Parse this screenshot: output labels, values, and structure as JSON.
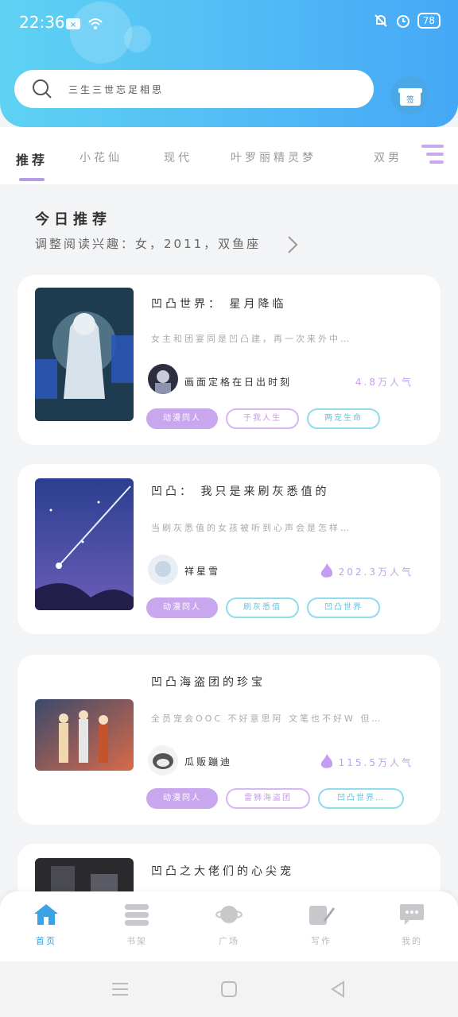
{
  "status": {
    "time": "22:36",
    "battery": "78"
  },
  "search": {
    "placeholder": "三生三世忘足相思"
  },
  "sign_in": {
    "label": "签"
  },
  "tabs": [
    {
      "label": "推荐",
      "active": true
    },
    {
      "label": "小花仙",
      "active": false
    },
    {
      "label": "现代",
      "active": false
    },
    {
      "label": "叶罗丽精灵梦",
      "active": false
    },
    {
      "label": "双男",
      "active": false
    }
  ],
  "recommend": {
    "title": "今日推荐",
    "subtitle": "调整阅读兴趣：女，2011，双鱼座"
  },
  "books": [
    {
      "title": "凹凸世界： 星月降临",
      "desc": "女主和团宴同是凹凸建，再一次来外中…",
      "author": "画面定格在日出时刻",
      "heat": "4.8万人气",
      "hot": false,
      "tags": [
        "动漫同人",
        "于我人生",
        "两宠生命"
      ]
    },
    {
      "title": "凹凸： 我只是来刷灰悉值的",
      "desc": "当刷灰悉值的女孩被听到心声会是怎样…",
      "author": "祥星雪",
      "heat": "202.3万人气",
      "hot": true,
      "tags": [
        "动漫同人",
        "刷灰悉值",
        "凹凸世界"
      ]
    },
    {
      "title": "凹凸海盗团的珍宝",
      "desc": "全员宠会OOC 不好意思阿 文笔也不好W 但…",
      "author": "瓜贩蹦迪",
      "heat": "115.5万人气",
      "hot": true,
      "tags": [
        "动漫同人",
        "雷狮海盗团",
        "凹凸世界…"
      ]
    },
    {
      "title": "凹凸之大佬们的心尖宠"
    }
  ],
  "bottom_nav": [
    {
      "label": "首页",
      "icon": "home-icon",
      "active": true
    },
    {
      "label": "书架",
      "icon": "bookshelf-icon",
      "active": false
    },
    {
      "label": "广场",
      "icon": "planet-icon",
      "active": false
    },
    {
      "label": "写作",
      "icon": "pen-icon",
      "active": false
    },
    {
      "label": "我的",
      "icon": "chat-icon",
      "active": false
    }
  ],
  "colors": {
    "header_start": "#5fd2f3",
    "header_end": "#45a8f7",
    "accent_purple": "#c9a7ee",
    "accent_teal": "#8fdcec",
    "nav_active": "#3aa3e8"
  }
}
